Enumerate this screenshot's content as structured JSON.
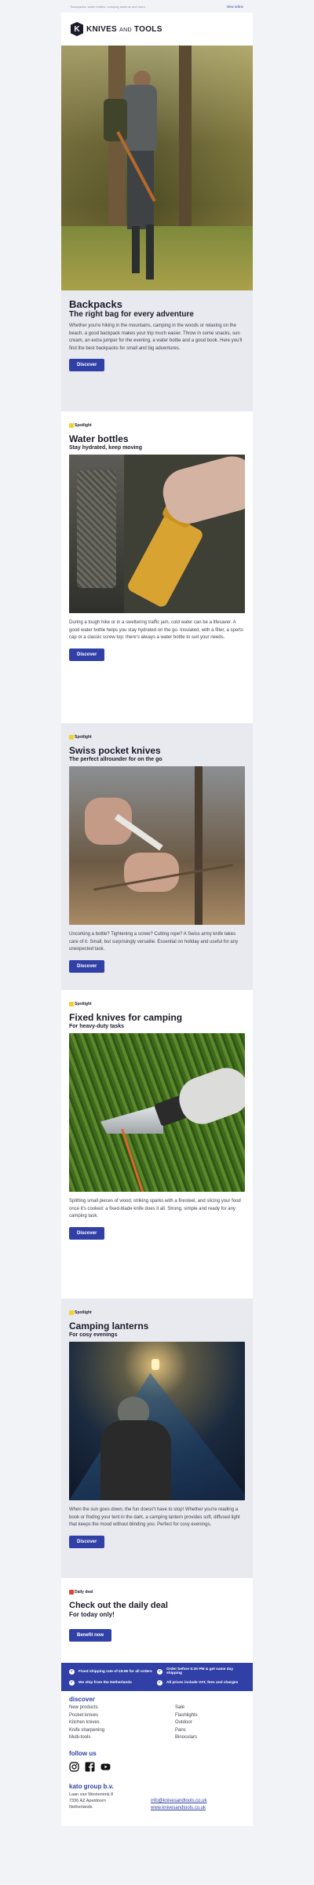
{
  "preheader": {
    "text": "Backpacks, water bottles, camping lanterns and more",
    "view_online": "View online"
  },
  "brand": {
    "name_part1": "KNIVES",
    "name_and": "AND",
    "name_part2": "TOOLS",
    "accent": "#3140a6"
  },
  "hero": {
    "title": "Backpacks",
    "subtitle": "The right bag for every adventure",
    "body": "Whether you're hiking in the mountains, camping in the woods or relaxing on the beach, a good backpack makes your trip much easier. Throw in some snacks, sun cream, an extra jumper for the evening, a water bottle and a good book. Here you'll find the best backpacks for small and big adventures.",
    "button": "Discover"
  },
  "spotlights": [
    {
      "tag": "Spotlight",
      "title": "Water bottles",
      "subtitle": "Stay hydrated, keep moving",
      "body": "During a tough hike or in a sweltering traffic jam, cold water can be a lifesaver. A good water bottle helps you stay hydrated on the go. Insulated, with a filter, a sports cap or a classic screw top: there's always a water bottle to suit your needs.",
      "button": "Discover"
    },
    {
      "tag": "Spotlight",
      "title": "Swiss pocket knives",
      "subtitle": "The perfect allrounder for on the go",
      "body": "Uncorking a bottle? Tightening a screw? Cutting rope? A Swiss army knife takes care of it. Small, but surprisingly versatile. Essential on holiday and useful for any unexpected task.",
      "button": "Discover"
    },
    {
      "tag": "Spotlight",
      "title": "Fixed knives for camping",
      "subtitle": "For heavy-duty tasks",
      "body": "Splitting small pieces of wood, striking sparks with a firesteel, and slicing your food once it's cooked: a fixed-blade knife does it all. Strong, simple and ready for any camping task.",
      "button": "Discover"
    },
    {
      "tag": "Spotlight",
      "title": "Camping lanterns",
      "subtitle": "For cosy evenings",
      "body": "When the sun goes down, the fun doesn't have to stop! Whether you're reading a book or finding your tent in the dark, a camping lantern provides soft, diffused light that keeps the mood without blinding you. Perfect for cosy evenings.",
      "button": "Discover"
    }
  ],
  "deal": {
    "tag": "Daily deal",
    "title": "Check out the daily deal",
    "subtitle": "For today only!",
    "button": "Benefit now"
  },
  "usps": [
    "Fixed shipping rate of £9.95 for all orders",
    "Order before 5:30 PM & get same day shipping",
    "We ship from the Netherlands",
    "All prices include VAT, fees and charges"
  ],
  "discover": {
    "title": "discover",
    "col1": [
      "New products",
      "Pocket knives",
      "Kitchen knives",
      "Knife sharpening",
      "Multi-tools"
    ],
    "col2": [
      "Sale",
      "Flashlights",
      "Outdoor",
      "Pans",
      "Binoculars"
    ]
  },
  "follow": {
    "title": "follow us",
    "icons": [
      "instagram-icon",
      "facebook-icon",
      "youtube-icon"
    ]
  },
  "company": {
    "name": "kato group b.v.",
    "address": [
      "Laan van Westenenk 8",
      "7336 AZ Apeldoorn",
      "Netherlands"
    ],
    "email": "info@knivesandtools.co.uk",
    "site": "www.knivesandtools.co.uk"
  }
}
